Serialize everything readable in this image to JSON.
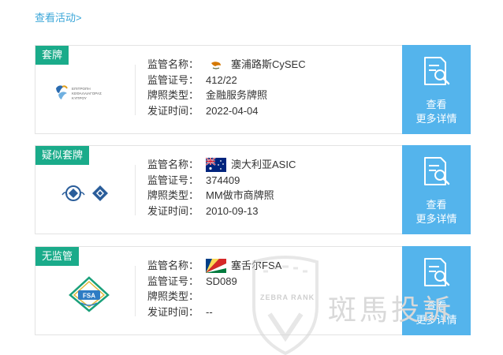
{
  "header": {
    "view_activity_link": "查看活动>"
  },
  "labels": {
    "regulator_name": "监管名称：",
    "license_number": "监管证号：",
    "license_type": "牌照类型：",
    "issue_date": "发证时间："
  },
  "detail_button": {
    "line1": "查看",
    "line2": "更多详情",
    "icon": "document-search-icon"
  },
  "cards": [
    {
      "badge": "套牌",
      "badge_color": "#1aab8a",
      "flag": "cyprus-flag-icon",
      "regulator": "塞浦路斯CySEC",
      "license_number": "412/22",
      "license_type": "金融服务牌照",
      "issue_date": "2022-04-04",
      "logo": "cysec-logo"
    },
    {
      "badge": "疑似套牌",
      "badge_color": "#1aab8a",
      "flag": "australia-flag-icon",
      "regulator": "澳大利亚ASIC",
      "license_number": "374409",
      "license_type": "MM做市商牌照",
      "issue_date": "2010-09-13",
      "logo": "asic-logo"
    },
    {
      "badge": "无监管",
      "badge_color": "#1aab8a",
      "flag": "seychelles-flag-icon",
      "regulator": "塞舌尔FSA",
      "license_number": "SD089",
      "license_type": "",
      "issue_date": "--",
      "logo": "fsa-logo"
    }
  ],
  "watermark": {
    "text": "斑馬投訴",
    "sub": "ZEBRA RANK"
  },
  "colors": {
    "accent": "#54b4ec",
    "badge": "#1aab8a",
    "link": "#3aa6d8"
  }
}
